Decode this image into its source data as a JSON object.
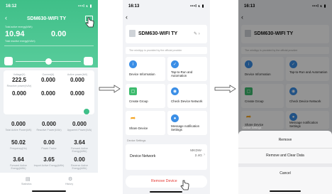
{
  "phone1": {
    "time": "16:12",
    "signal": "•••l ᴌ ▮",
    "title": "SDM630-WIFI TY",
    "energy_left": "10.94",
    "energy_right": "0.00",
    "energy_left_label": "Total active energy(kWh)",
    "energy_right_label": "Total reactive energy(kVArh)",
    "row1_labels": [
      "Voltage(V)",
      "Current(A)",
      "Active power(kW)"
    ],
    "row1_values": [
      "222.5",
      "0.000",
      "0.000"
    ],
    "row2_labels": [
      "Reactive power(kVAr)",
      "",
      ""
    ],
    "row2_values": [
      "0.000",
      "0.000",
      "0.000"
    ],
    "grid_values": [
      "0.000",
      "0.000",
      "0.000",
      "50.02",
      "0.00",
      "3.64",
      "3.64",
      "3.65",
      "0.00"
    ],
    "grid_labels": [
      "Total Active Power(kW)",
      "Reactive Power(kVAr)",
      "Apparent Power(kVA)",
      "Frequency(Hz)",
      "Power Factor",
      "Forward Active Energy(kWh)",
      "Forward Active Energy(kWh)",
      "Import Active Energy(kWh)",
      "Reverse Active Energy(kWh)"
    ],
    "tab_left": "Statistics",
    "tab_right": "History"
  },
  "phone2": {
    "time": "16:13",
    "signal": "•••l ᴌ ▮",
    "device_name": "SDM630-WIFI TY",
    "notice": "The miniApp is provided by the official provider",
    "tiles": [
      {
        "label": "Device Information",
        "icon": "info-icon",
        "color": "#3a8ee6"
      },
      {
        "label": "Tap-to-Run and Automation",
        "icon": "check-icon",
        "color": "#3a8ee6"
      },
      {
        "label": "Create Group",
        "icon": "group-icon",
        "color": "#3dbb6e"
      },
      {
        "label": "Check Device Network",
        "icon": "network-icon",
        "color": "#3a8ee6"
      },
      {
        "label": "Share Device",
        "icon": "share-icon",
        "color": "#f5a524"
      },
      {
        "label": "Message notification Settings",
        "icon": "bell-icon",
        "color": "#3a8ee6"
      }
    ],
    "settings_header": "Device Settings",
    "network_label": "Device Network",
    "network_value": "MKDW-2.4G",
    "remove_button": "Remove Device"
  },
  "phone3": {
    "time": "16:13",
    "signal": "•••l ᴌ ▮",
    "device_name": "SDM630-WIFI TY",
    "notice": "The miniApp is provided by the official provider",
    "tiles": [
      {
        "label": "Device Information"
      },
      {
        "label": "Tap-to-Run and Automation"
      },
      {
        "label": "Create Group"
      },
      {
        "label": "Check Device Network"
      },
      {
        "label": "Share Device"
      },
      {
        "label": "Message notification Settings"
      }
    ],
    "settings_header": "Device Settings",
    "sheet": {
      "remove": "Remove",
      "remove_clear": "Remove and Clear Data",
      "cancel": "Cancel"
    }
  },
  "colors": {
    "header_green": "#4cc592",
    "accent_blue": "#3a8ee6",
    "remove_red": "#e53935"
  }
}
